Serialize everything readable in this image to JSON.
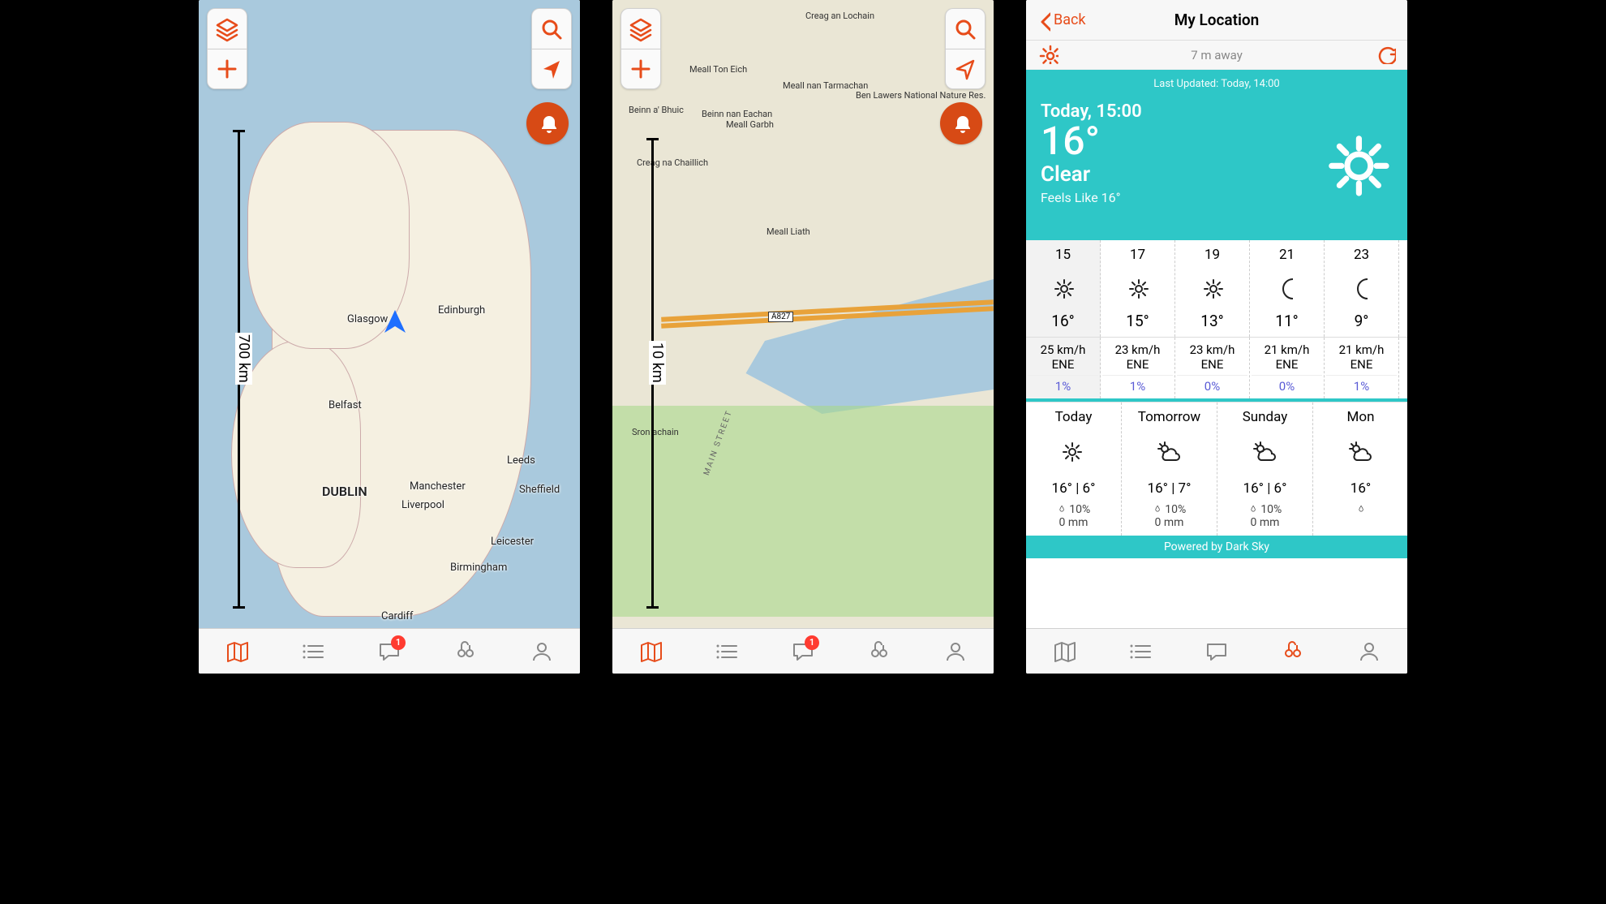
{
  "screen1": {
    "scale": "700 km",
    "cities": {
      "edinburgh": "Edinburgh",
      "glasgow": "Glasgow",
      "belfast": "Belfast",
      "dublin": "DUBLIN",
      "leeds": "Leeds",
      "manchester": "Manchester",
      "liverpool": "Liverpool",
      "sheffield": "Sheffield",
      "leicester": "Leicester",
      "birmingham": "Birmingham",
      "cardiff": "Cardiff"
    },
    "tabs": {
      "messages_badge": "1"
    }
  },
  "screen2": {
    "scale": "10 km",
    "labels": {
      "beinn_bhuic": "Beinn a' Bhuic",
      "creag_chaillich": "Creag na Chaillich",
      "meall_ton_eich": "Meall Ton Eich",
      "beinn_eachan": "Beinn nan Eachan",
      "meall_garbh": "Meall Garbh",
      "creag_lochain": "Creag an Lochain",
      "meall_tarmachan": "Meall nan Tarmachan",
      "meall_liath": "Meall Liath",
      "ben_lawers": "Ben Lawers National Nature Res.",
      "road": "A827",
      "main_street": "MAIN STREET",
      "sron": "Sron achain"
    },
    "tabs": {
      "messages_badge": "1"
    }
  },
  "screen3": {
    "nav": {
      "back": "Back",
      "title": "My Location"
    },
    "sub": {
      "distance": "7 m away"
    },
    "hero": {
      "updated": "Last Updated: Today, 14:00",
      "time": "Today, 15:00",
      "temp": "16°",
      "cond": "Clear",
      "feels": "Feels Like 16°"
    },
    "hours": [
      {
        "h": "15",
        "t": "16°",
        "icon": "sun"
      },
      {
        "h": "17",
        "t": "15°",
        "icon": "sun"
      },
      {
        "h": "19",
        "t": "13°",
        "icon": "sun"
      },
      {
        "h": "21",
        "t": "11°",
        "icon": "moon"
      },
      {
        "h": "23",
        "t": "9°",
        "icon": "moon"
      }
    ],
    "winds": [
      {
        "ws": "25 km/h",
        "wd": "ENE",
        "pr": "1%"
      },
      {
        "ws": "23 km/h",
        "wd": "ENE",
        "pr": "1%"
      },
      {
        "ws": "23 km/h",
        "wd": "ENE",
        "pr": "0%"
      },
      {
        "ws": "21 km/h",
        "wd": "ENE",
        "pr": "0%"
      },
      {
        "ws": "21 km/h",
        "wd": "ENE",
        "pr": "1%"
      }
    ],
    "days": [
      {
        "n": "Today",
        "icon": "sun",
        "hl": "16° | 6°",
        "r1": "10%",
        "r2": "0 mm"
      },
      {
        "n": "Tomorrow",
        "icon": "partly",
        "hl": "16° | 7°",
        "r1": "10%",
        "r2": "0 mm"
      },
      {
        "n": "Sunday",
        "icon": "partly",
        "hl": "16° | 6°",
        "r1": "10%",
        "r2": "0 mm"
      },
      {
        "n": "Mon",
        "icon": "partly",
        "hl": "16°",
        "r1": "",
        "r2": ""
      }
    ],
    "powered": "Powered by Dark Sky"
  }
}
